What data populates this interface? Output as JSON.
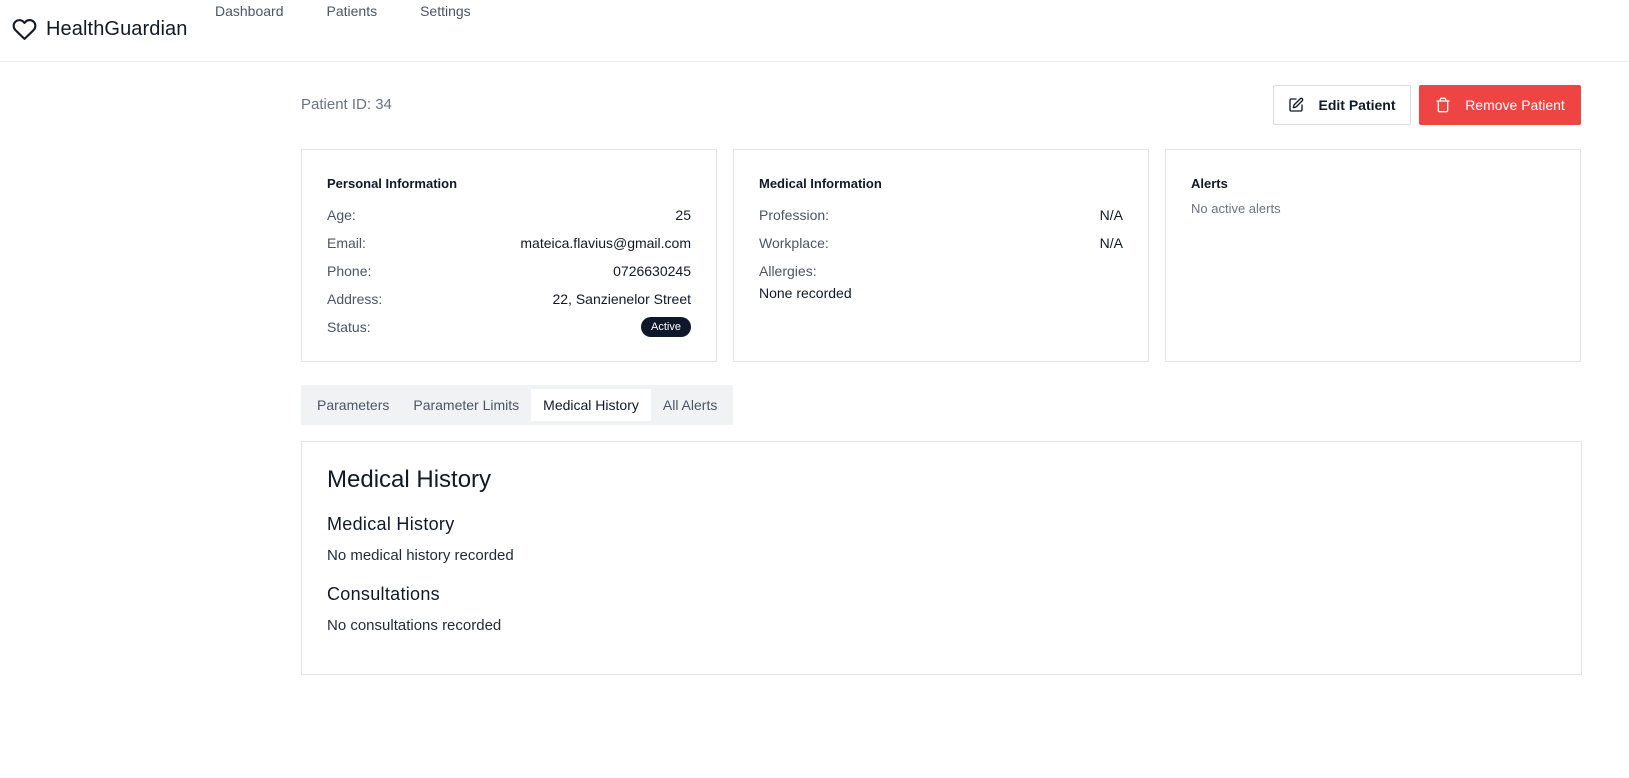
{
  "app": {
    "name": "HealthGuardian",
    "logo_icon": "heart-icon"
  },
  "nav": [
    "Dashboard",
    "Patients",
    "Settings"
  ],
  "patient": {
    "id_label": "Patient ID: 34"
  },
  "actions": {
    "edit_label": "Edit Patient",
    "edit_icon": "edit-icon",
    "remove_label": "Remove Patient",
    "remove_icon": "trash-icon",
    "remove_color": "#ef4444"
  },
  "personal": {
    "title": "Personal Information",
    "rows": [
      {
        "label": "Age:",
        "value": "25"
      },
      {
        "label": "Email:",
        "value": "mateica.flavius@gmail.com"
      },
      {
        "label": "Phone:",
        "value": "0726630245"
      },
      {
        "label": "Address:",
        "value": "22, Sanzienelor Street"
      }
    ],
    "status_label": "Status:",
    "status_value": "Active"
  },
  "medical": {
    "title": "Medical Information",
    "rows": [
      {
        "label": "Profession:",
        "value": "N/A"
      },
      {
        "label": "Workplace:",
        "value": "N/A"
      }
    ],
    "allergies_label": "Allergies:",
    "allergies_value": "None recorded"
  },
  "alerts": {
    "title": "Alerts",
    "empty": "No active alerts"
  },
  "tabs": [
    {
      "label": "Parameters",
      "active": false
    },
    {
      "label": "Parameter Limits",
      "active": false
    },
    {
      "label": "Medical History",
      "active": true
    },
    {
      "label": "All Alerts",
      "active": false
    }
  ],
  "history": {
    "heading": "Medical History",
    "section1_title": "Medical History",
    "section1_text": "No medical history recorded",
    "section2_title": "Consultations",
    "section2_text": "No consultations recorded"
  }
}
